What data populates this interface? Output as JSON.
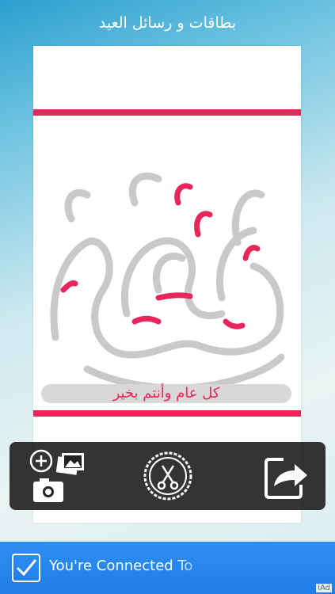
{
  "header": {
    "title": "بطاقات و رسائل العيد"
  },
  "card": {
    "greeting": "كل عام وأنتم بخير",
    "accent_color": "#e8265a",
    "calligraphy_color": "#c9c9c9"
  },
  "toolbar": {
    "photos_icon": "add-photo-camera-icon",
    "edit_icon": "scissors-badge-icon",
    "share_icon": "share-arrow-icon"
  },
  "ad_banner": {
    "message": "You're Connected To",
    "tag": "iAd"
  }
}
